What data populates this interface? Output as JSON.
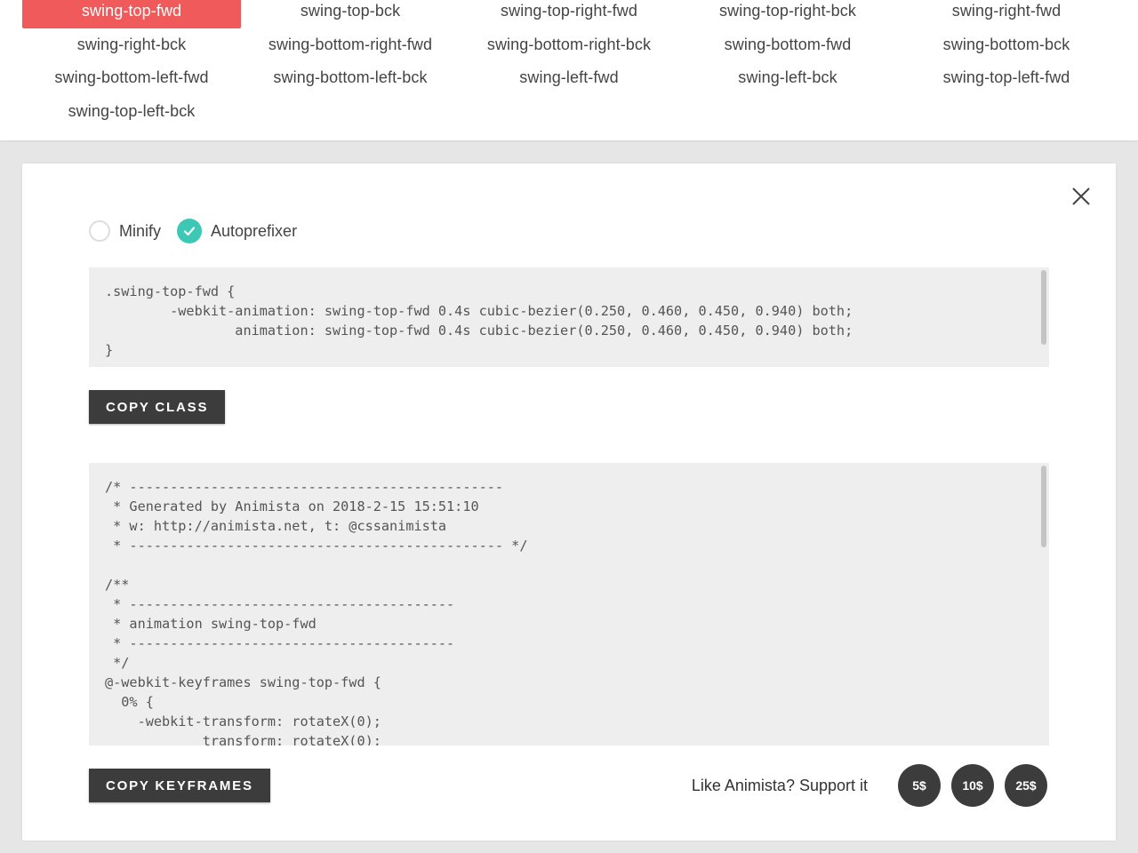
{
  "animations": [
    {
      "label": "swing-top-fwd",
      "active": true
    },
    {
      "label": "swing-top-bck"
    },
    {
      "label": "swing-top-right-fwd"
    },
    {
      "label": "swing-top-right-bck"
    },
    {
      "label": "swing-right-fwd"
    },
    {
      "label": "swing-right-bck"
    },
    {
      "label": "swing-bottom-right-fwd"
    },
    {
      "label": "swing-bottom-right-bck"
    },
    {
      "label": "swing-bottom-fwd"
    },
    {
      "label": "swing-bottom-bck"
    },
    {
      "label": "swing-bottom-left-fwd"
    },
    {
      "label": "swing-bottom-left-bck"
    },
    {
      "label": "swing-left-fwd"
    },
    {
      "label": "swing-left-bck"
    },
    {
      "label": "swing-top-left-fwd"
    },
    {
      "label": "swing-top-left-bck"
    }
  ],
  "options": {
    "minify": {
      "label": "Minify",
      "checked": false
    },
    "autoprefixer": {
      "label": "Autoprefixer",
      "checked": true
    }
  },
  "class_code": ".swing-top-fwd {\n        -webkit-animation: swing-top-fwd 0.4s cubic-bezier(0.250, 0.460, 0.450, 0.940) both;\n                animation: swing-top-fwd 0.4s cubic-bezier(0.250, 0.460, 0.450, 0.940) both;\n}",
  "keyframes_code": "/* ----------------------------------------------\n * Generated by Animista on 2018-2-15 15:51:10\n * w: http://animista.net, t: @cssanimista\n * ---------------------------------------------- */\n\n/**\n * ----------------------------------------\n * animation swing-top-fwd\n * ----------------------------------------\n */\n@-webkit-keyframes swing-top-fwd {\n  0% {\n    -webkit-transform: rotateX(0);\n            transform: rotateX(0);",
  "buttons": {
    "copy_class": "COPY CLASS",
    "copy_keyframes": "COPY KEYFRAMES"
  },
  "support": {
    "text": "Like Animista? Support it",
    "amounts": [
      "5$",
      "10$",
      "25$"
    ]
  },
  "colors": {
    "active": "#f05a5a",
    "check": "#3cc8b4",
    "button": "#3c3c3c"
  }
}
